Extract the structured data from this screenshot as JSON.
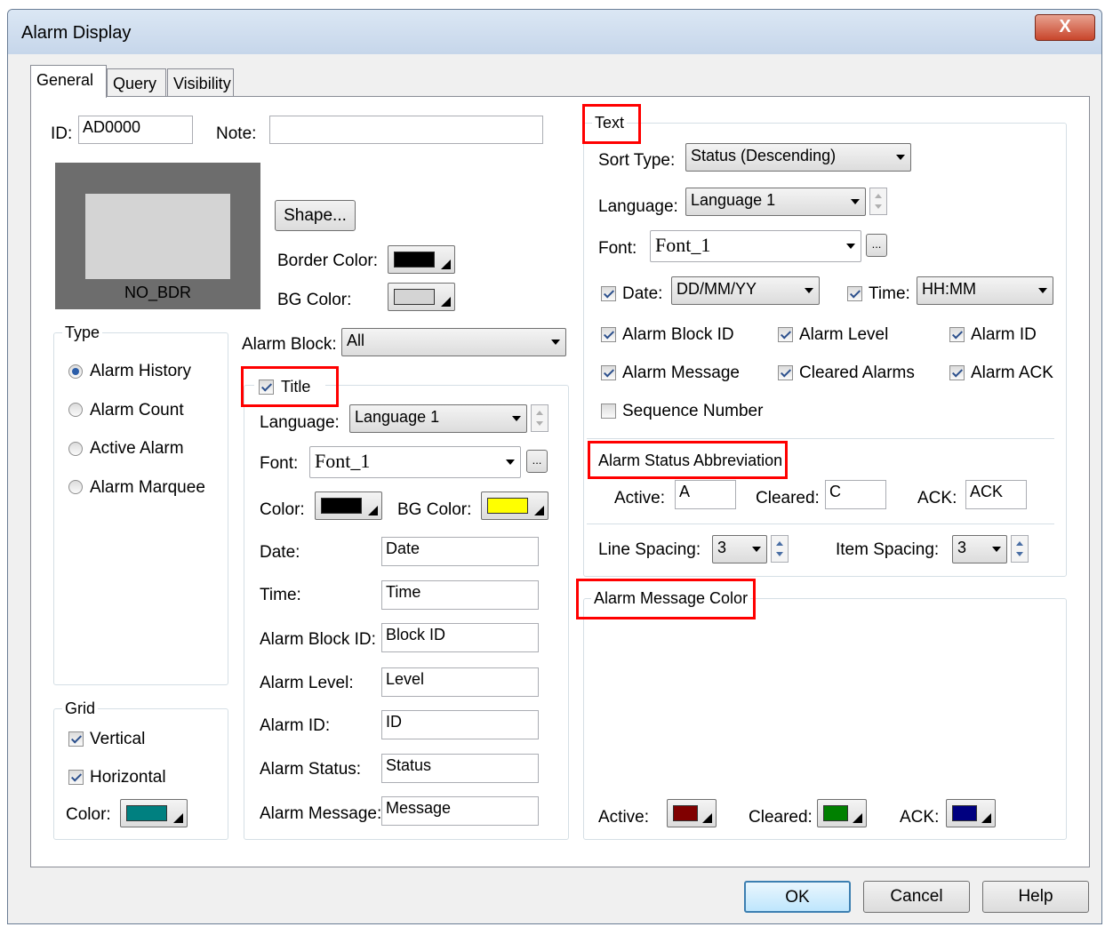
{
  "window": {
    "title": "Alarm Display",
    "close": "X"
  },
  "tabs": [
    {
      "label": "General"
    },
    {
      "label": "Query"
    },
    {
      "label": "Visibility"
    }
  ],
  "general": {
    "id_label": "ID:",
    "id_value": "AD0000",
    "note_label": "Note:",
    "note_value": "",
    "preview_label": "NO_BDR",
    "shape_button": "Shape...",
    "border_color_label": "Border Color:",
    "border_color": "#000000",
    "bg_color_label": "BG Color:",
    "bg_color": "#d4d4d4",
    "alarm_block_label": "Alarm Block:",
    "alarm_block_value": "All"
  },
  "type_group": {
    "legend": "Type",
    "options": [
      {
        "label": "Alarm History",
        "selected": true
      },
      {
        "label": "Alarm Count",
        "selected": false
      },
      {
        "label": "Active Alarm",
        "selected": false
      },
      {
        "label": "Alarm Marquee",
        "selected": false
      }
    ]
  },
  "grid_group": {
    "legend": "Grid",
    "vertical_label": "Vertical",
    "vertical_checked": true,
    "horizontal_label": "Horizontal",
    "horizontal_checked": true,
    "color_label": "Color:",
    "color": "#008080"
  },
  "title_group": {
    "legend": "Title",
    "checked": true,
    "language_label": "Language:",
    "language_value": "Language 1",
    "font_label": "Font:",
    "font_value": "Font_1",
    "font_more": "...",
    "color_label": "Color:",
    "color": "#000000",
    "bg_color_label": "BG Color:",
    "bg_color": "#ffff00",
    "fields": [
      {
        "label": "Date:",
        "value": "Date"
      },
      {
        "label": "Time:",
        "value": "Time"
      },
      {
        "label": "Alarm Block ID:",
        "value": "Block ID"
      },
      {
        "label": "Alarm Level:",
        "value": "Level"
      },
      {
        "label": "Alarm ID:",
        "value": "ID"
      },
      {
        "label": "Alarm Status:",
        "value": "Status"
      },
      {
        "label": "Alarm Message:",
        "value": "Message"
      }
    ]
  },
  "text_group": {
    "legend": "Text",
    "sort_type_label": "Sort Type:",
    "sort_type_value": "Status (Descending)",
    "language_label": "Language:",
    "language_value": "Language 1",
    "font_label": "Font:",
    "font_value": "Font_1",
    "font_more": "...",
    "date_label": "Date:",
    "date_checked": true,
    "date_value": "DD/MM/YY",
    "time_label": "Time:",
    "time_checked": true,
    "time_value": "HH:MM",
    "checks": [
      {
        "label": "Alarm Block ID",
        "checked": true
      },
      {
        "label": "Alarm Level",
        "checked": true
      },
      {
        "label": "Alarm ID",
        "checked": true
      },
      {
        "label": "Alarm Message",
        "checked": true
      },
      {
        "label": "Cleared Alarms",
        "checked": true
      },
      {
        "label": "Alarm ACK",
        "checked": true
      },
      {
        "label": "Sequence Number",
        "checked": false
      }
    ],
    "abbrev_legend": "Alarm Status Abbreviation",
    "active_label": "Active:",
    "active_value": "A",
    "cleared_label": "Cleared:",
    "cleared_value": "C",
    "ack_label": "ACK:",
    "ack_value": "ACK",
    "line_spacing_label": "Line Spacing:",
    "line_spacing_value": "3",
    "item_spacing_label": "Item Spacing:",
    "item_spacing_value": "3"
  },
  "message_color_group": {
    "legend": "Alarm Message Color",
    "active_label": "Active:",
    "active_color": "#800000",
    "cleared_label": "Cleared:",
    "cleared_color": "#008000",
    "ack_label": "ACK:",
    "ack_color": "#000080"
  },
  "buttons": {
    "ok": "OK",
    "cancel": "Cancel",
    "help": "Help"
  }
}
